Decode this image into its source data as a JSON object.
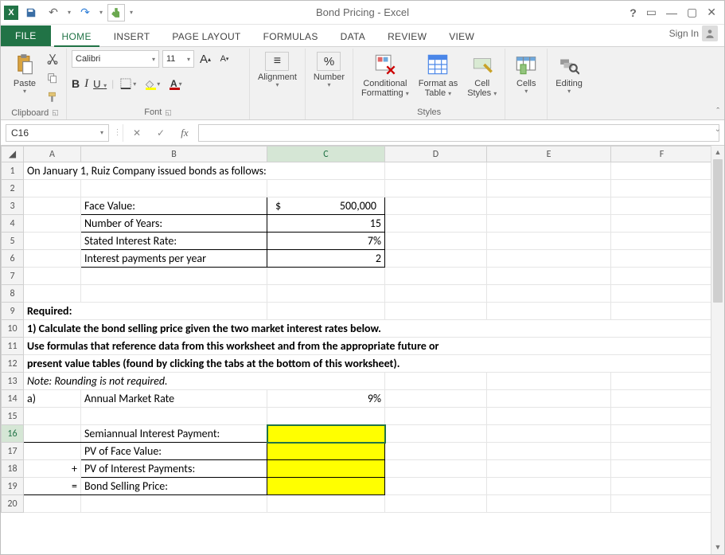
{
  "titlebar": {
    "app_name": "X",
    "title": "Bond Pricing - Excel"
  },
  "window_controls": {
    "help": "?",
    "ribbon_opts": "▭",
    "minimize": "—",
    "restore": "▢",
    "close": "✕"
  },
  "tabs": {
    "file": "FILE",
    "home": "HOME",
    "insert": "INSERT",
    "page_layout": "PAGE LAYOUT",
    "formulas": "FORMULAS",
    "data": "DATA",
    "review": "REVIEW",
    "view": "VIEW",
    "signin": "Sign In"
  },
  "ribbon": {
    "clipboard": {
      "paste": "Paste",
      "label": "Clipboard"
    },
    "font": {
      "name": "Calibri",
      "size": "11",
      "bold": "B",
      "italic": "I",
      "underline": "U",
      "grow": "A",
      "shrink": "A",
      "fontcolor_letter": "A",
      "label": "Font"
    },
    "alignment": {
      "btn": "Alignment",
      "icon": "≡"
    },
    "number": {
      "btn": "Number",
      "icon": "%"
    },
    "styles": {
      "cond": "Conditional\nFormatting",
      "table": "Format as\nTable",
      "cell": "Cell\nStyles",
      "label": "Styles"
    },
    "cells": {
      "btn": "Cells"
    },
    "editing": {
      "btn": "Editing"
    }
  },
  "formula_bar": {
    "namebox": "C16",
    "cancel": "✕",
    "enter": "✓",
    "fx": "fx",
    "value": ""
  },
  "columns": [
    "A",
    "B",
    "C",
    "D",
    "E",
    "F"
  ],
  "cells": {
    "A1": "On January 1,  Ruiz Company issued bonds as follows:",
    "B3": "Face Value:",
    "C3_sym": "$",
    "C3_val": "500,000",
    "B4": "Number of Years:",
    "C4": "15",
    "B5": "Stated Interest Rate:",
    "C5": "7%",
    "B6": "Interest payments per year",
    "C6": "2",
    "A9": "Required:",
    "A10": "1) Calculate the bond selling price given the two market interest rates below.",
    "A11": "Use formulas that reference data from this worksheet and from the appropriate future or",
    "A12": "present value tables (found by clicking the tabs at the bottom of this worksheet).",
    "A13": "Note:  Rounding is not required.",
    "A14": "a)",
    "B14": "Annual Market Rate",
    "C14": "9%",
    "B16": "Semiannual Interest Payment:",
    "B17": "PV of Face Value:",
    "A18": "+",
    "B18": "PV of Interest Payments:",
    "A19": "=",
    "B19": "Bond Selling Price:"
  },
  "selected_cell": "C16",
  "active_row": "16"
}
